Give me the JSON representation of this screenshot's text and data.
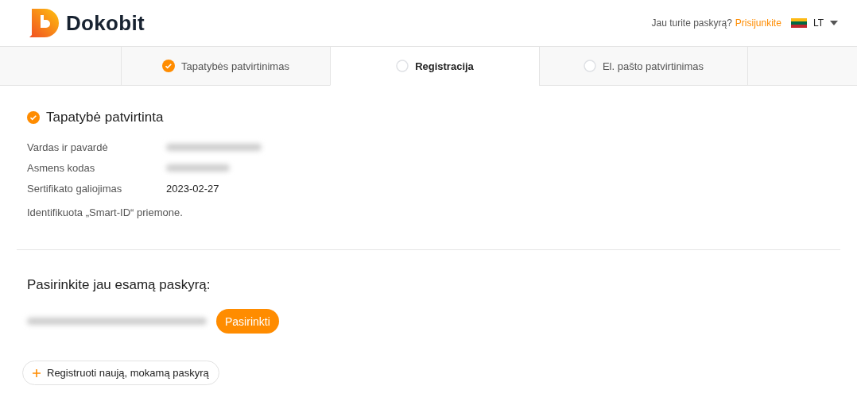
{
  "header": {
    "brand": "Dokobit",
    "account_prompt": "Jau turite paskyrą?",
    "login_link": "Prisijunkite",
    "language": "LT"
  },
  "steps": [
    {
      "label": "Tapatybės patvirtinimas",
      "done": true,
      "selected": false
    },
    {
      "label": "Registracija",
      "done": false,
      "selected": true
    },
    {
      "label": "El. pašto patvirtinimas",
      "done": false,
      "selected": false
    }
  ],
  "identity": {
    "title": "Tapatybė patvirtinta",
    "fields": [
      {
        "label": "Vardas ir pavardė",
        "redacted": true
      },
      {
        "label": "Asmens kodas",
        "redacted": true
      },
      {
        "label": "Sertifikato galiojimas",
        "value": "2023-02-27",
        "redacted": false
      }
    ],
    "note": "Identifikuota „Smart-ID“ priemone."
  },
  "accounts": {
    "title": "Pasirinkite jau esamą paskyrą:",
    "items": [
      {
        "redacted": true,
        "button": "Pasirinkti"
      }
    ],
    "new_account": "Registruoti naują, mokamą paskyrą"
  }
}
